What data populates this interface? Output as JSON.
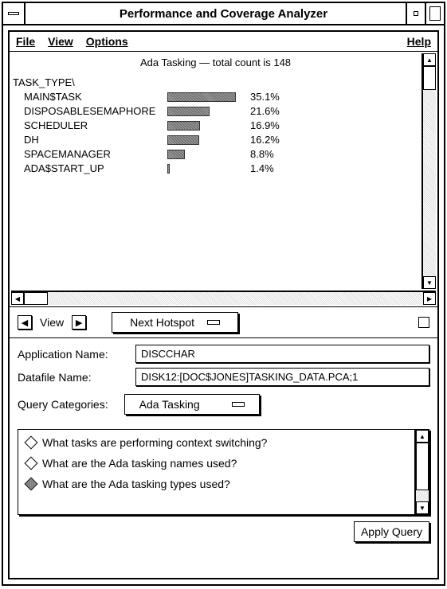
{
  "window": {
    "title": "Performance and Coverage Analyzer"
  },
  "menu": {
    "file": "File",
    "view": "View",
    "options": "Options",
    "help": "Help"
  },
  "chart_data": {
    "type": "bar",
    "title": "Ada Tasking — total count is 148",
    "header": "TASK_TYPE\\",
    "items": [
      {
        "name": "MAIN$TASK",
        "pct": 35.1
      },
      {
        "name": "DISPOSABLESEMAPHORE",
        "pct": 21.6
      },
      {
        "name": "SCHEDULER",
        "pct": 16.9
      },
      {
        "name": "DH",
        "pct": 16.2
      },
      {
        "name": "SPACEMANAGER",
        "pct": 8.8
      },
      {
        "name": "ADA$START_UP",
        "pct": 1.4
      }
    ],
    "max_pct": 36
  },
  "controls": {
    "view_label": "View",
    "next_hotspot": "Next Hotspot"
  },
  "form": {
    "app_label": "Application Name:",
    "app_value": "DISCCHAR",
    "data_label": "Datafile Name:",
    "data_value": "DISK12:[DOC$JONES]TASKING_DATA.PCA;1",
    "query_cat_label": "Query Categories:",
    "query_cat_value": "Ada Tasking"
  },
  "queries": [
    {
      "text": "What tasks are performing context switching?",
      "selected": false
    },
    {
      "text": "What are the Ada tasking names used?",
      "selected": false
    },
    {
      "text": "What are the Ada tasking types used?",
      "selected": true
    }
  ],
  "footer": {
    "apply": "Apply Query"
  }
}
